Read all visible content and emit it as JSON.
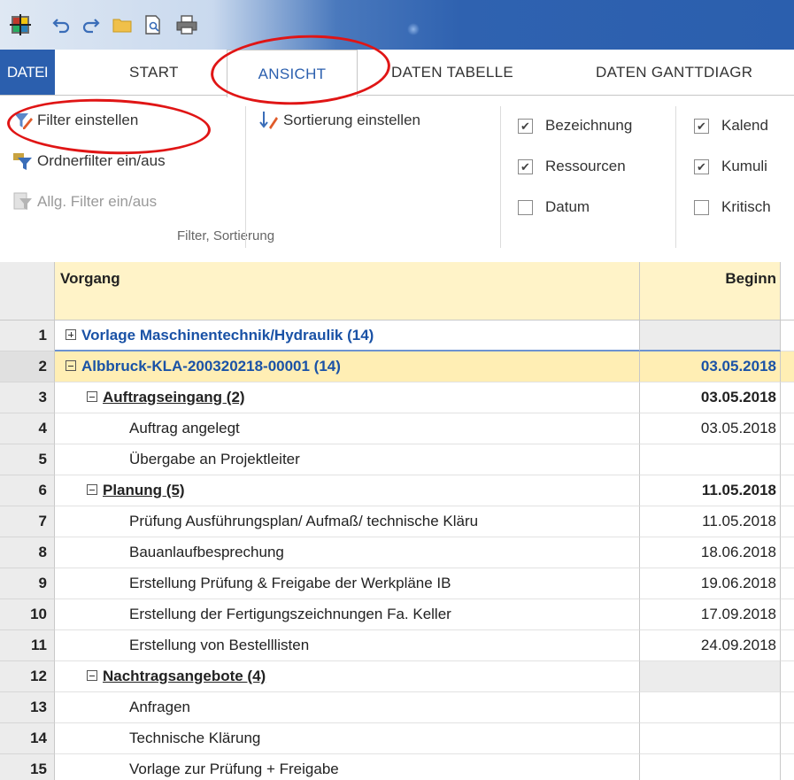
{
  "toolbar": {
    "quick_access": [
      "app-logo-icon",
      "undo-icon",
      "redo-icon",
      "folder-icon",
      "print-preview-icon",
      "print-icon"
    ]
  },
  "tabs": {
    "file": "DATEI",
    "start": "START",
    "ansicht": "ANSICHT",
    "daten_tabelle": "DATEN TABELLE",
    "daten_gantt": "DATEN GANTTDIAGR"
  },
  "ribbon": {
    "filter_einstellen": "Filter einstellen",
    "ordnerfilter": "Ordnerfilter ein/aus",
    "allg_filter": "Allg. Filter ein/aus",
    "sortierung": "Sortierung einstellen",
    "group_label": "Filter, Sortierung",
    "checkboxes": {
      "bezeichnung": {
        "label": "Bezeichnung",
        "checked": true
      },
      "ressourcen": {
        "label": "Ressourcen",
        "checked": true
      },
      "datum": {
        "label": "Datum",
        "checked": false
      },
      "kalender": {
        "label": "Kalend",
        "checked": true
      },
      "kumuliert": {
        "label": "Kumuli",
        "checked": true
      },
      "kritisch": {
        "label": "Kritisch",
        "checked": false
      }
    }
  },
  "grid": {
    "columns": {
      "vorgang": "Vorgang",
      "beginn": "Beginn"
    },
    "rows": [
      {
        "num": "1",
        "level": 0,
        "toggle": "plus",
        "name": "Vorlage Maschinentechnik/Hydraulik (14)",
        "beginn": ""
      },
      {
        "num": "2",
        "level": 0,
        "toggle": "minus",
        "name": "Albbruck-KLA-200320218-00001 (14)",
        "beginn": "03.05.2018"
      },
      {
        "num": "3",
        "level": 1,
        "toggle": "minus",
        "name": "Auftragseingang (2)",
        "beginn": "03.05.2018"
      },
      {
        "num": "4",
        "level": 2,
        "toggle": "",
        "name": "Auftrag angelegt",
        "beginn": "03.05.2018"
      },
      {
        "num": "5",
        "level": 2,
        "toggle": "",
        "name": "Übergabe an Projektleiter",
        "beginn": ""
      },
      {
        "num": "6",
        "level": 1,
        "toggle": "minus",
        "name": "Planung (5)",
        "beginn": "11.05.2018"
      },
      {
        "num": "7",
        "level": 2,
        "toggle": "",
        "name": "Prüfung Ausführungsplan/ Aufmaß/ technische Kläru",
        "beginn": "11.05.2018"
      },
      {
        "num": "8",
        "level": 2,
        "toggle": "",
        "name": "Bauanlaufbesprechung",
        "beginn": "18.06.2018"
      },
      {
        "num": "9",
        "level": 2,
        "toggle": "",
        "name": "Erstellung Prüfung & Freigabe der Werkpläne IB",
        "beginn": "19.06.2018"
      },
      {
        "num": "10",
        "level": 2,
        "toggle": "",
        "name": "Erstellung der Fertigungszeichnungen  Fa. Keller",
        "beginn": "17.09.2018"
      },
      {
        "num": "11",
        "level": 2,
        "toggle": "",
        "name": "Erstellung von Bestelllisten",
        "beginn": "24.09.2018"
      },
      {
        "num": "12",
        "level": 1,
        "toggle": "minus",
        "name": "Nachtragsangebote (4)",
        "beginn": ""
      },
      {
        "num": "13",
        "level": 2,
        "toggle": "",
        "name": "Anfragen",
        "beginn": ""
      },
      {
        "num": "14",
        "level": 2,
        "toggle": "",
        "name": "Technische Klärung",
        "beginn": ""
      },
      {
        "num": "15",
        "level": 2,
        "toggle": "",
        "name": "Vorlage zur Prüfung + Freigabe",
        "beginn": ""
      }
    ]
  },
  "colors": {
    "accent": "#2b5fae",
    "header_fill": "#fff3c8",
    "selected_row": "#ffeeb4",
    "annotation": "#e01515"
  }
}
